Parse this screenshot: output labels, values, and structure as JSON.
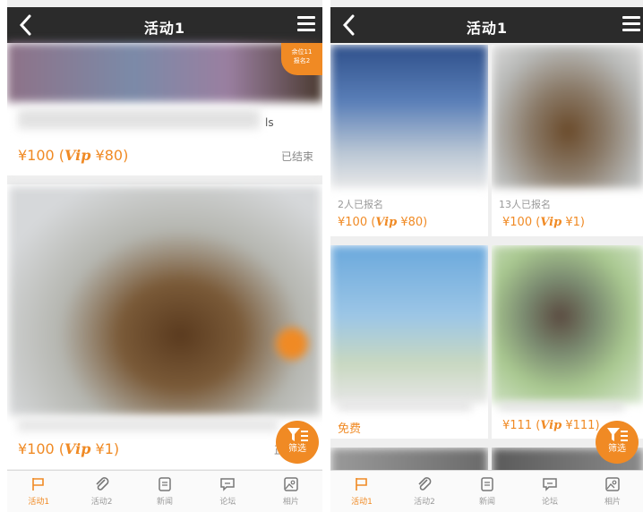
{
  "screens": [
    {
      "header": {
        "title": "活动1"
      },
      "badge": {
        "line1": "余位11",
        "line2": "报名2"
      },
      "cards": [
        {
          "price_text": "¥100",
          "vip_label": "Vip",
          "vip_price": "¥80",
          "status": "已结束",
          "blurred_title_tail": "ls"
        },
        {
          "price_text": "¥100",
          "vip_label": "Vip",
          "vip_price": "¥1",
          "status": "正"
        }
      ],
      "filter": {
        "label": "筛选"
      }
    },
    {
      "header": {
        "title": "活动1"
      },
      "cards": [
        {
          "count": "2人已报名",
          "price_text": "¥100",
          "vip_label": "Vip",
          "vip_price": "¥80"
        },
        {
          "count": "13人已报名",
          "price_text": "¥100",
          "vip_label": "Vip",
          "vip_price": "¥1"
        },
        {
          "price_text": "免费"
        },
        {
          "price_text": "¥111",
          "vip_label": "Vip",
          "vip_price": "¥111"
        }
      ],
      "filter": {
        "label": "筛选"
      }
    }
  ],
  "bottom_nav": [
    {
      "label": "活动1",
      "icon": "flag-icon",
      "active": true
    },
    {
      "label": "活动2",
      "icon": "paperclip-icon",
      "active": false
    },
    {
      "label": "新闻",
      "icon": "document-icon",
      "active": false
    },
    {
      "label": "论坛",
      "icon": "chat-icon",
      "active": false
    },
    {
      "label": "相片",
      "icon": "photo-icon",
      "active": false
    }
  ],
  "colors": {
    "accent": "#f08a24",
    "header": "#2b2b2b",
    "muted": "#999999"
  }
}
